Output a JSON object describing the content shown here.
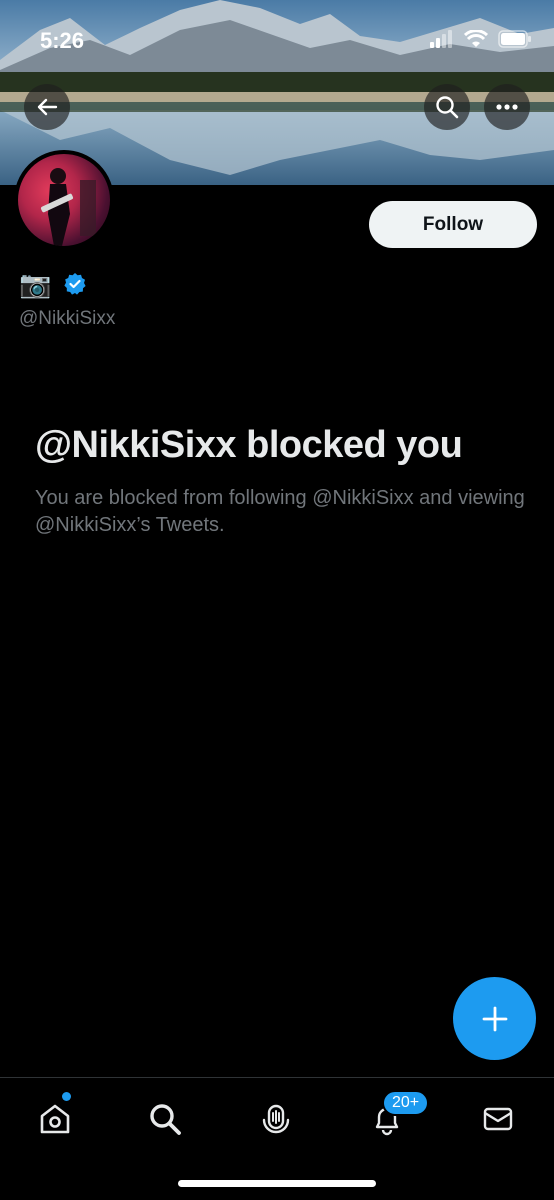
{
  "status_bar": {
    "time": "5:26"
  },
  "profile": {
    "name_emoji": "📷",
    "handle": "@NikkiSixx",
    "follow_label": "Follow"
  },
  "blocked": {
    "title": "@NikkiSixx blocked you",
    "description": "You are blocked from following @NikkiSixx and viewing @NikkiSixx’s Tweets."
  },
  "nav": {
    "notifications_badge": "20+"
  },
  "colors": {
    "accent": "#1d9bf0",
    "background": "#000000",
    "muted_text": "#71767b"
  },
  "icons": [
    "back-arrow-icon",
    "search-icon",
    "more-icon",
    "verified-badge-icon",
    "compose-plus-icon",
    "home-icon",
    "spaces-icon",
    "bell-icon",
    "mail-icon"
  ]
}
